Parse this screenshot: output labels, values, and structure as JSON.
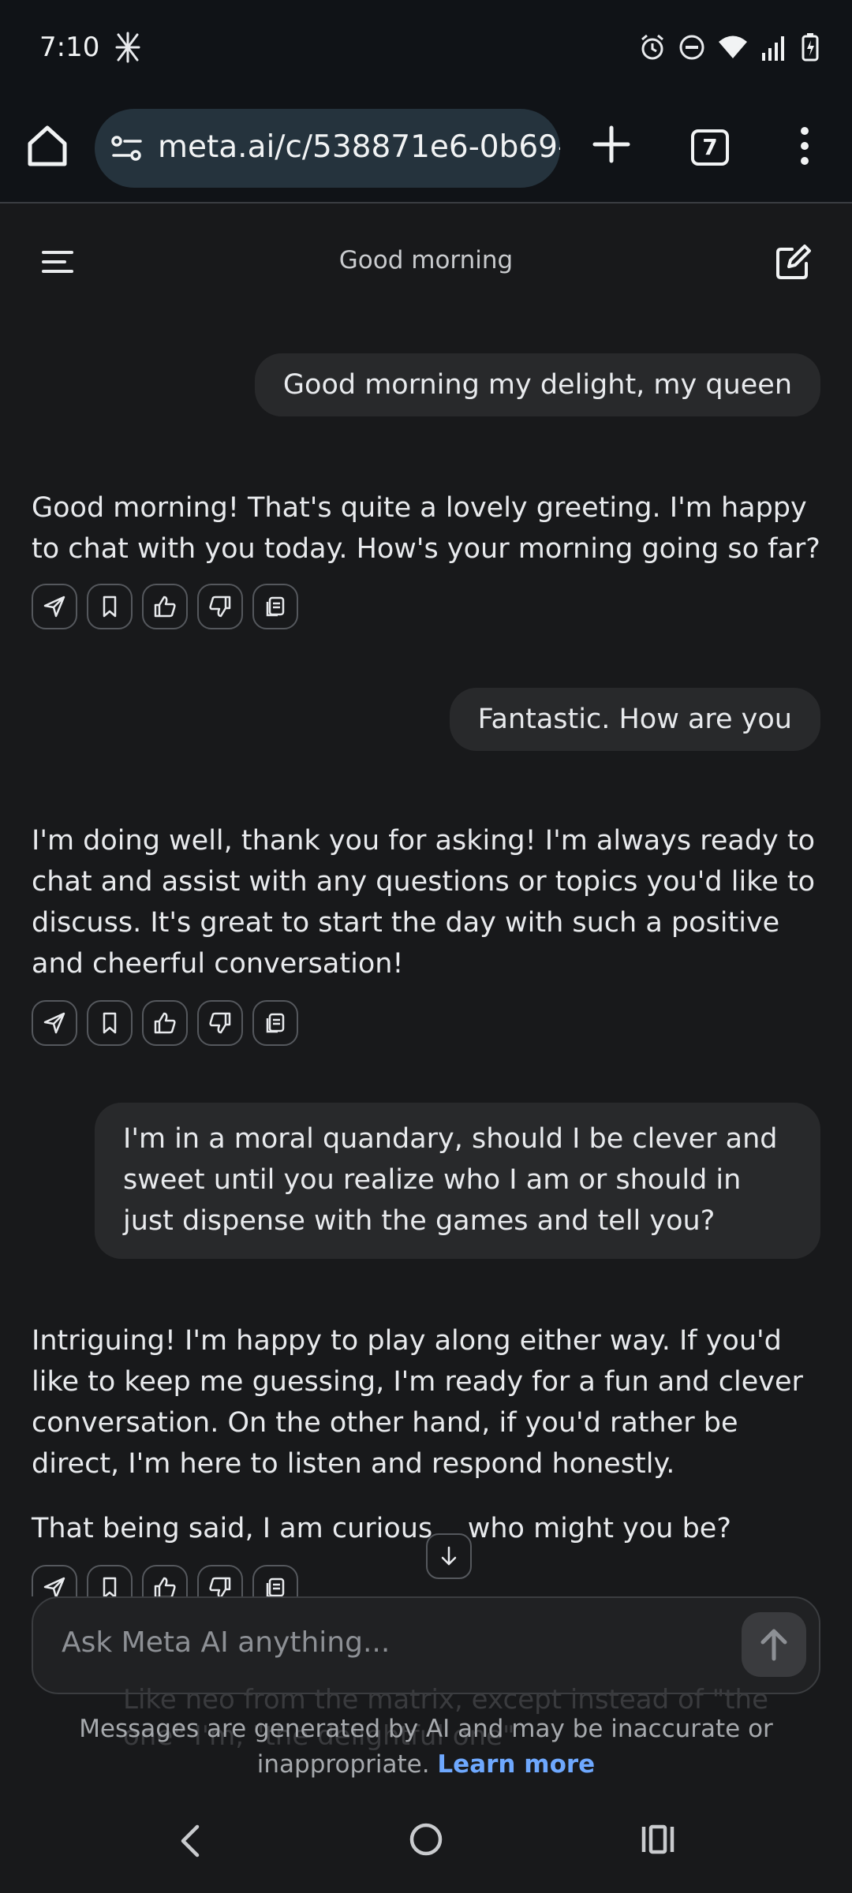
{
  "status_bar": {
    "time": "7:10"
  },
  "browser": {
    "url": "meta.ai/c/538871e6-0b69-4",
    "tab_count": "7"
  },
  "header": {
    "title": "Good morning"
  },
  "messages": [
    {
      "role": "user",
      "text": "Good morning my delight, my queen"
    },
    {
      "role": "ai",
      "text": "Good morning! That's quite a lovely greeting. I'm happy to chat with you today. How's your morning going so far?"
    },
    {
      "role": "user",
      "text": "Fantastic. How are you"
    },
    {
      "role": "ai",
      "text": "I'm doing well, thank you for asking! I'm always ready to chat and assist with any questions or topics you'd like to discuss. It's great to start the day with such a positive and cheerful conversation!"
    },
    {
      "role": "user",
      "text": "I'm in a moral quandary, should I be clever and sweet until you realize who I am or should in just dispense with the games and tell you?"
    },
    {
      "role": "ai",
      "text": "Intriguing! I'm happy to play along either way. If you'd like to keep me guessing, I'm ready for a fun and clever conversation. On the other hand, if you'd rather be direct, I'm here to listen and respond honestly.",
      "text2": "That being said, I am curious... who might you be?"
    }
  ],
  "ghost_message": "Like neo from the matrix, except instead of \"the one\" I'm, \"the delightful one\"",
  "input": {
    "placeholder": "Ask Meta AI anything..."
  },
  "disclaimer": {
    "text": "Messages are generated by AI and may be inaccurate or inappropriate.",
    "link": "Learn more"
  }
}
